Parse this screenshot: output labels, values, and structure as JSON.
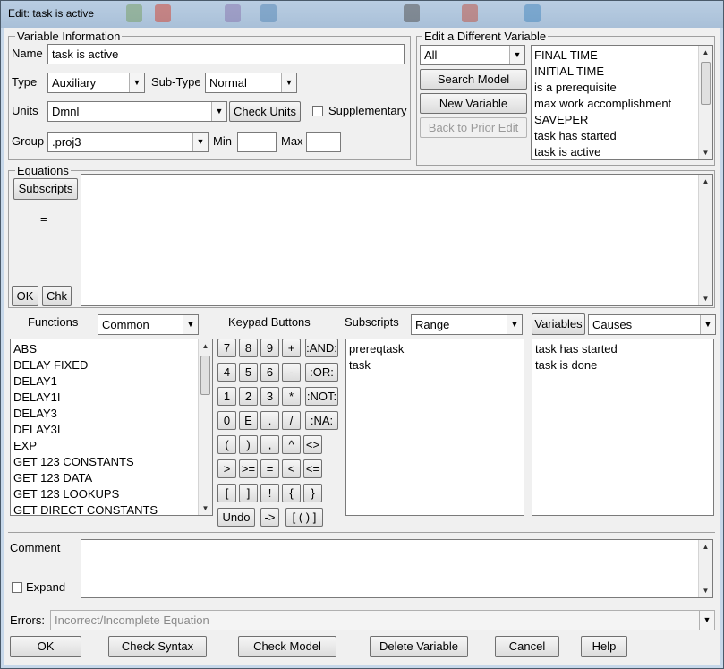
{
  "window": {
    "title": "Edit: task is active"
  },
  "variable_info": {
    "group_title": "Variable Information",
    "name_label": "Name",
    "name_value": "task is active",
    "type_label": "Type",
    "type_value": "Auxiliary",
    "subtype_label": "Sub-Type",
    "subtype_value": "Normal",
    "units_label": "Units",
    "units_value": "Dmnl",
    "check_units_label": "Check Units",
    "supplementary_label": "Supplementary",
    "group_label": "Group",
    "group_value": ".proj3",
    "min_label": "Min",
    "min_value": "",
    "max_label": "Max",
    "max_value": ""
  },
  "edit_different": {
    "group_title": "Edit a Different Variable",
    "filter_value": "All",
    "search_model_label": "Search Model",
    "new_variable_label": "New Variable",
    "back_label": "Back to Prior Edit",
    "variables": [
      "FINAL TIME",
      "INITIAL TIME",
      "is a prerequisite",
      "max work accomplishment",
      "SAVEPER",
      "task has started",
      "task is active"
    ]
  },
  "equations": {
    "group_title": "Equations",
    "subscripts_label": "Subscripts",
    "equals_label": "=",
    "ok_label": "OK",
    "chk_label": "Chk",
    "text": ""
  },
  "functions": {
    "title": "Functions",
    "category_value": "Common",
    "items": [
      "ABS",
      "DELAY FIXED",
      "DELAY1",
      "DELAY1I",
      "DELAY3",
      "DELAY3I",
      "EXP",
      "GET 123 CONSTANTS",
      "GET 123 DATA",
      "GET 123 LOOKUPS",
      "GET DIRECT CONSTANTS"
    ]
  },
  "keypad": {
    "title": "Keypad Buttons",
    "rows": [
      [
        "7",
        "8",
        "9",
        "+",
        ":AND:"
      ],
      [
        "4",
        "5",
        "6",
        "-",
        ":OR:"
      ],
      [
        "1",
        "2",
        "3",
        "*",
        ":NOT:"
      ],
      [
        "0",
        "E",
        ".",
        "/",
        ":NA:"
      ],
      [
        "(",
        ")",
        ",",
        "^",
        "<>"
      ],
      [
        ">",
        ">=",
        "=",
        "<",
        "<="
      ],
      [
        "[",
        "]",
        "!",
        "{",
        "}"
      ]
    ],
    "undo_label": "Undo",
    "arrow_label": "->",
    "bracket_label": "[ ( ) ]"
  },
  "subscripts": {
    "title": "Subscripts",
    "range_value": "Range",
    "items": [
      "prereqtask",
      "task"
    ]
  },
  "variables_panel": {
    "button_label": "Variables",
    "causes_value": "Causes",
    "items": [
      "task has started",
      "task is done"
    ]
  },
  "comment": {
    "label": "Comment",
    "expand_label": "Expand",
    "text": ""
  },
  "errors": {
    "label": "Errors:",
    "value": "Incorrect/Incomplete Equation"
  },
  "bottom_buttons": {
    "ok": "OK",
    "check_syntax": "Check Syntax",
    "check_model": "Check Model",
    "delete_variable": "Delete Variable",
    "cancel": "Cancel",
    "help": "Help"
  }
}
